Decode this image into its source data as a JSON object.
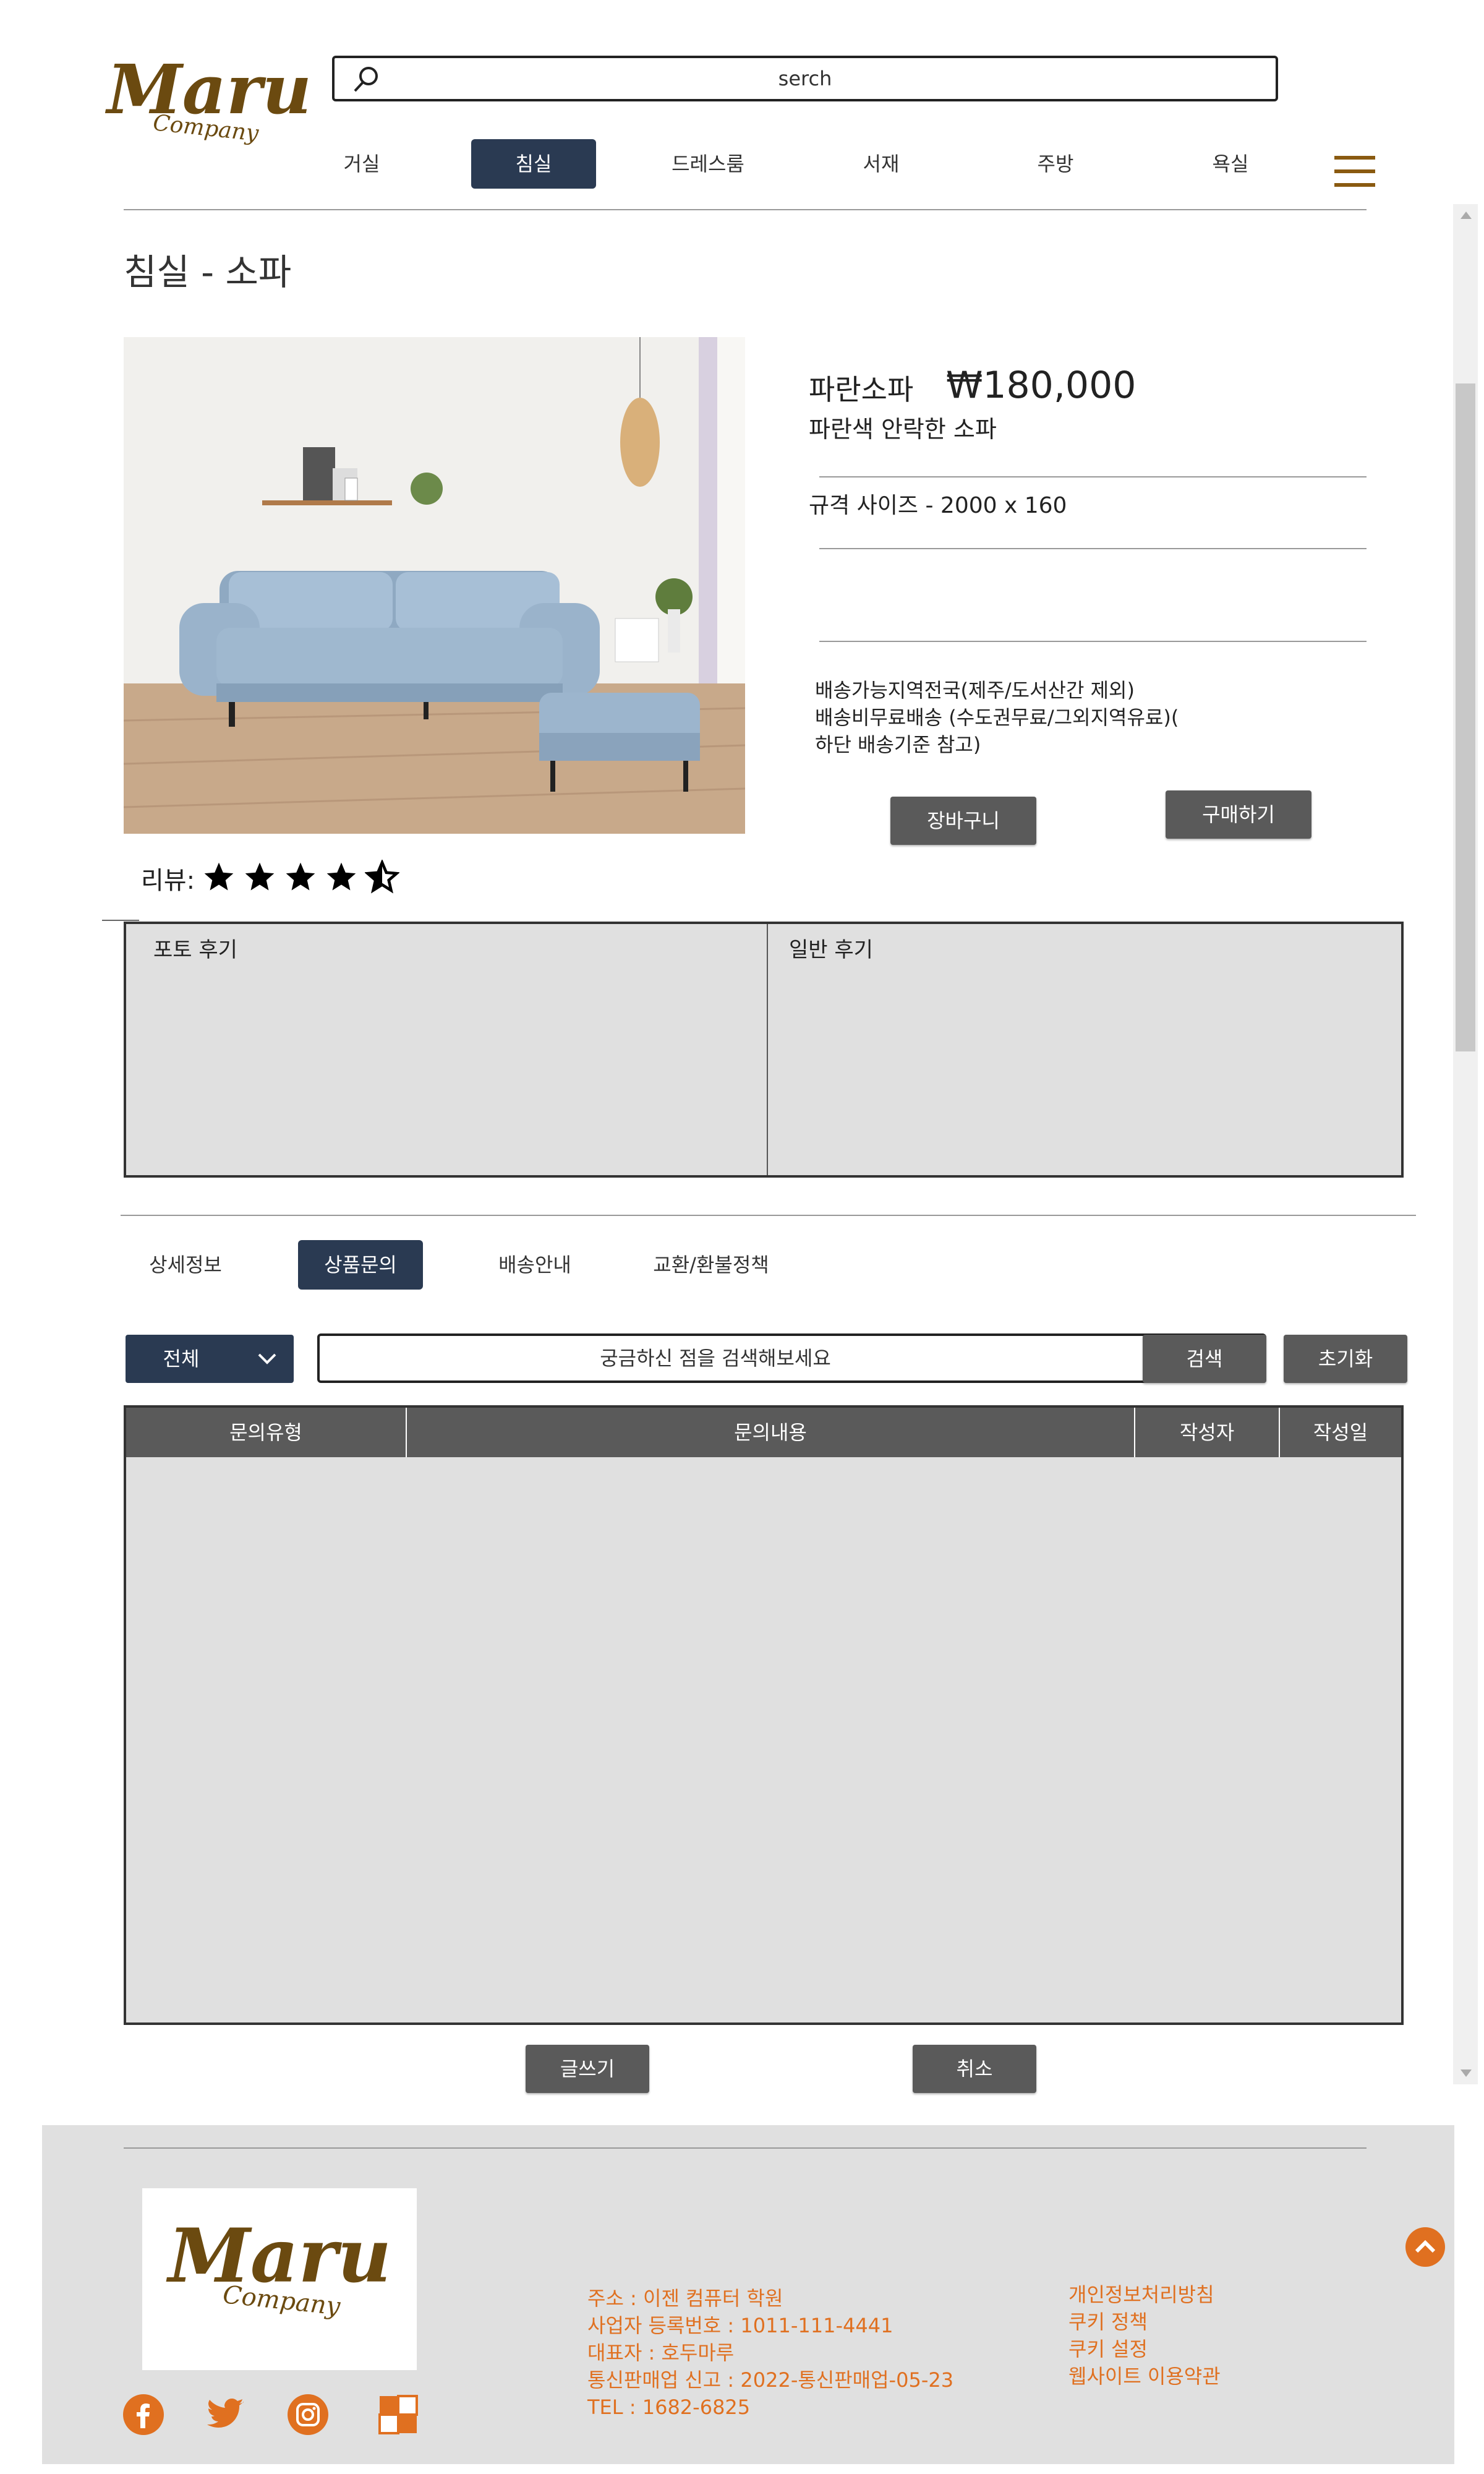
{
  "header": {
    "logo_main": "Maru",
    "logo_sub": "Company",
    "search_text": "serch",
    "nav": [
      "거실",
      "침실",
      "드레스룸",
      "서재",
      "주방",
      "욕실"
    ],
    "active_nav": "침실",
    "accent_color": "#8a5a10"
  },
  "page": {
    "title": "침실 - 소파"
  },
  "product": {
    "name": "파란소파",
    "price": "₩180,000",
    "description": "파란색 안락한 소파",
    "spec": "규격 사이즈 - 2000 x 160",
    "delivery_lines": [
      "배송가능지역전국(제주/도서산간 제외)",
      "배송비무료배송 (수도권무료/그외지역유료)(",
      "하단 배송기준 참고)"
    ],
    "cart_button": "장바구니",
    "buy_button": "구매하기",
    "review_label": "리뷰:",
    "rating": 4.5
  },
  "reviews": {
    "photo": "포토 후기",
    "general": "일반 후기"
  },
  "tabs": [
    "상세정보",
    "상품문의",
    "배송안내",
    "교환/환불정책"
  ],
  "active_tab": "상품문의",
  "inquiry": {
    "filter": "전체",
    "placeholder": "궁금하신 점을 검색해보세요",
    "search_button": "검색",
    "reset_button": "초기화",
    "columns": [
      "문의유형",
      "문의내용",
      "작성자",
      "작성일"
    ],
    "write_button": "글쓰기",
    "cancel_button": "취소"
  },
  "footer": {
    "logo_main": "Maru",
    "logo_sub": "Company",
    "info": [
      "주소 : 이젠 컴퓨터 학원",
      "사업자 등록번호 : 1011-111-4441",
      "대표자 : 호두마루",
      "통신판매업 신고 : 2022-통신판매업-05-23",
      "TEL : 1682-6825"
    ],
    "links": [
      "개인정보처리방침",
      "쿠키 정책",
      "쿠키 설정",
      "웹사이트 이용약관"
    ],
    "social": [
      "facebook-icon",
      "twitter-icon",
      "instagram-icon",
      "flickr-icon"
    ],
    "text_color": "#e07020"
  }
}
